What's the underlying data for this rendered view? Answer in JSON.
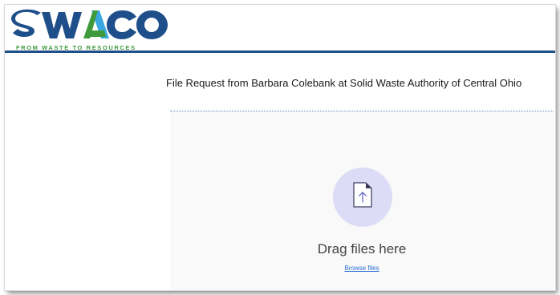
{
  "brand": {
    "logo_text": "SWACO",
    "tagline": "FROM WASTE TO RESOURCES",
    "colors": {
      "primary_blue": "#1f4f8a",
      "green": "#3f9a3b",
      "light_blue": "#39a8e0"
    }
  },
  "request": {
    "title": "File Request from Barbara Colebank at Solid Waste Authority of Central Ohio"
  },
  "dropzone": {
    "icon": "upload-file-icon",
    "message": "Drag files here",
    "browse_label": "Browse files",
    "colors": {
      "circle": "#dcdcf7",
      "link": "#2a6fd6"
    }
  }
}
